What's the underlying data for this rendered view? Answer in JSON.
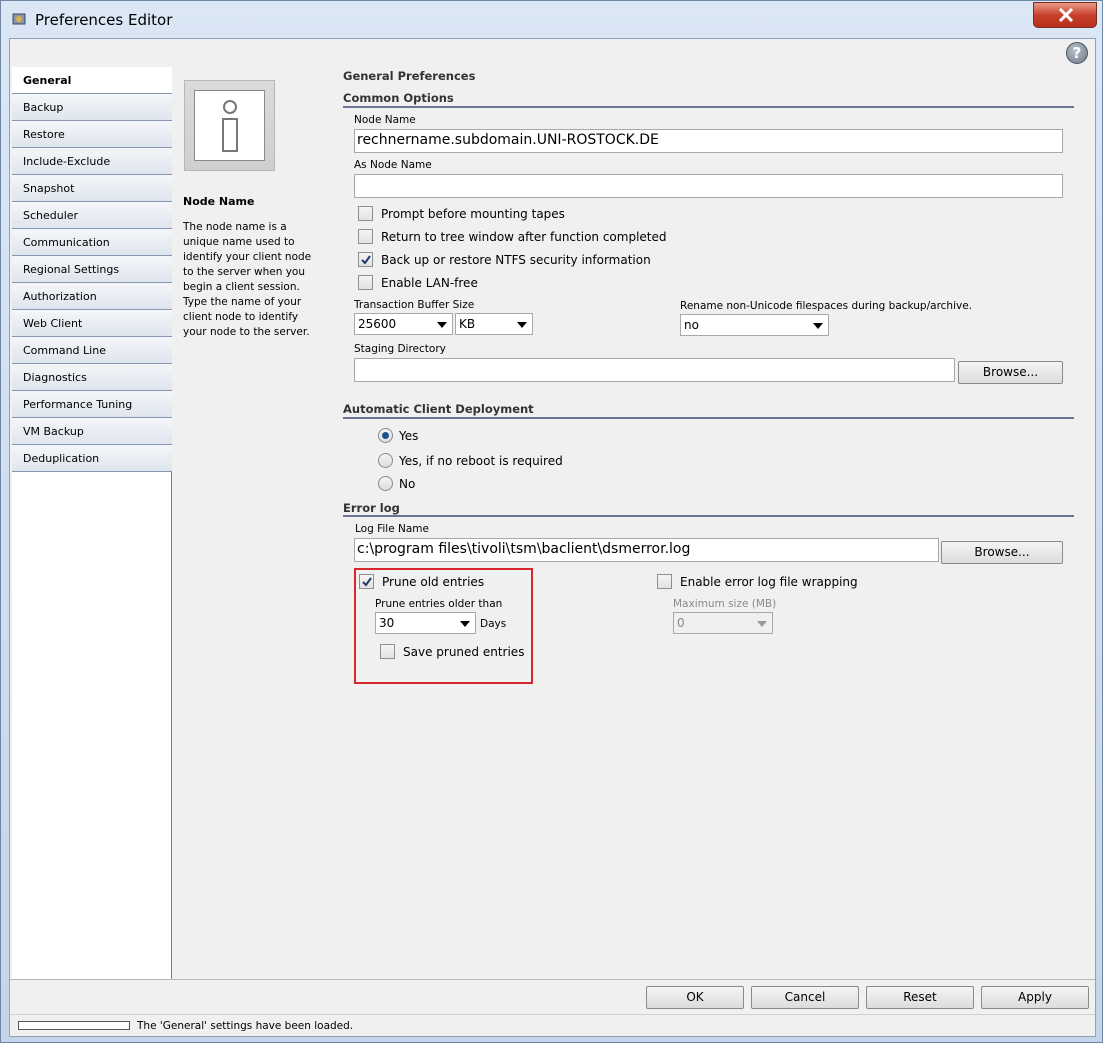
{
  "window": {
    "title": "Preferences Editor"
  },
  "nav": {
    "items": [
      {
        "label": "General",
        "active": true
      },
      {
        "label": "Backup"
      },
      {
        "label": "Restore"
      },
      {
        "label": "Include-Exclude"
      },
      {
        "label": "Snapshot"
      },
      {
        "label": "Scheduler"
      },
      {
        "label": "Communication"
      },
      {
        "label": "Regional Settings"
      },
      {
        "label": "Authorization"
      },
      {
        "label": "Web Client"
      },
      {
        "label": "Command Line"
      },
      {
        "label": "Diagnostics"
      },
      {
        "label": "Performance Tuning"
      },
      {
        "label": "VM Backup"
      },
      {
        "label": "Deduplication"
      }
    ]
  },
  "info": {
    "title": "Node Name",
    "body": "The node name is a unique name used to identify your client node to the server when you begin a client session. Type the name of your client node to identify your node to the server."
  },
  "content": {
    "page_title": "General Preferences",
    "common": {
      "title": "Common Options",
      "node_name_label": "Node Name",
      "node_name_value": "rechnername.subdomain.UNI-ROSTOCK.DE",
      "as_node_label": "As Node Name",
      "as_node_value": "",
      "chk_prompt": "Prompt before mounting tapes",
      "chk_return": "Return to tree window after function completed",
      "chk_ntfs": "Back up or restore NTFS security information",
      "chk_lan": "Enable LAN-free",
      "tbs_label": "Transaction Buffer Size",
      "tbs_value": "25600",
      "tbs_unit": "KB",
      "rename_label": "Rename non-Unicode filespaces during backup/archive.",
      "rename_value": "no",
      "staging_label": "Staging Directory",
      "staging_value": "",
      "browse": "Browse..."
    },
    "deploy": {
      "title": "Automatic Client Deployment",
      "opt_yes": "Yes",
      "opt_noreboot": "Yes, if no reboot is required",
      "opt_no": "No"
    },
    "errorlog": {
      "title": "Error log",
      "log_label": "Log File Name",
      "log_value": "c:\\program files\\tivoli\\tsm\\baclient\\dsmerror.log",
      "browse": "Browse...",
      "chk_prune": "Prune old entries",
      "prune_older_label": "Prune entries older than",
      "prune_value": "30",
      "prune_unit": "Days",
      "chk_save": "Save pruned entries",
      "chk_wrap": "Enable error log file wrapping",
      "max_size_label": "Maximum size (MB)",
      "max_size_value": "0"
    }
  },
  "buttons": {
    "ok": "OK",
    "cancel": "Cancel",
    "reset": "Reset",
    "apply": "Apply"
  },
  "status": {
    "text": "The 'General' settings have been loaded."
  },
  "colors": {
    "highlight": "#d7262d",
    "section_line": "#6a7496",
    "close": "#c9412d"
  }
}
